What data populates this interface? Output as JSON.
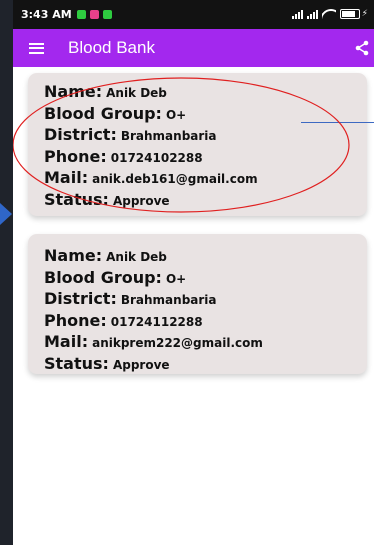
{
  "status_bar": {
    "time": "3:43 AM",
    "battery_level": "85",
    "app_icon_colors": [
      "#2ecc40",
      "#e9408b",
      "#2ecc40"
    ]
  },
  "app_bar": {
    "title": "Blood Bank",
    "menu_icon": "menu-icon",
    "share_icon": "share-icon",
    "color": "#a328ee"
  },
  "donors": [
    {
      "name_label": "Name:",
      "name": "Anik Deb",
      "blood_group_label": "Blood Group:",
      "blood_group": "O+",
      "district_label": "District:",
      "district": "Brahmanbaria",
      "phone_label": "Phone:",
      "phone": "01724102288",
      "mail_label": "Mail:",
      "mail": "anik.deb161@gmail.com",
      "status_label": "Status:",
      "status": "Approve"
    },
    {
      "name_label": "Name:",
      "name": "Anik Deb",
      "blood_group_label": "Blood Group:",
      "blood_group": "O+",
      "district_label": "District:",
      "district": "Brahmanbaria",
      "phone_label": "Phone:",
      "phone": "01724112288",
      "mail_label": "Mail:",
      "mail": "anikprem222@gmail.com",
      "status_label": "Status:",
      "status": "Approve"
    }
  ],
  "annotation_colors": {
    "ellipse": "#e02020",
    "arrow": "#2f66c9"
  }
}
